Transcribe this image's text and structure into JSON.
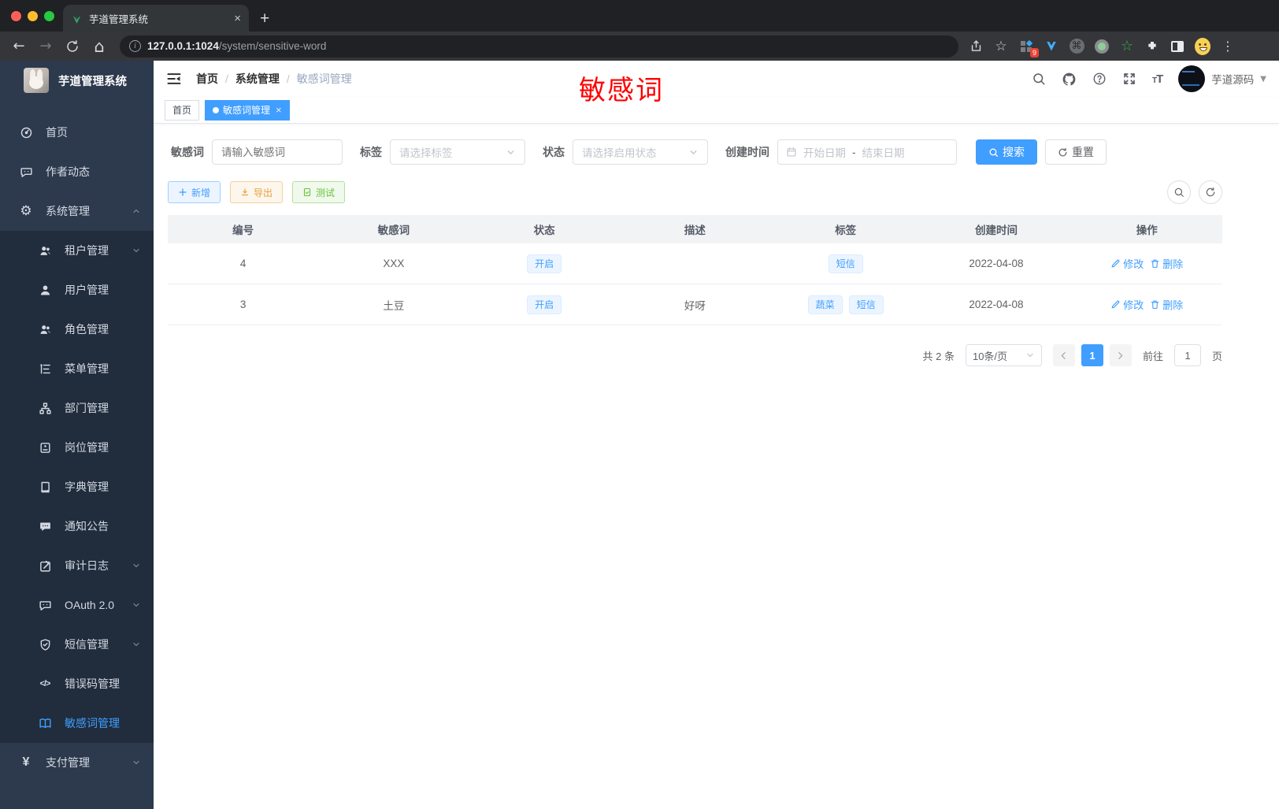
{
  "browser": {
    "tab_title": "芋道管理系统",
    "url_host": "127.0.0.1:1024",
    "url_path": "/system/sensitive-word",
    "extension_badge": "9"
  },
  "sidebar": {
    "title": "芋道管理系统",
    "items": [
      {
        "icon": "dashboard-icon",
        "label": "首页",
        "level": "root",
        "arrow": "",
        "active": false
      },
      {
        "icon": "chat-icon",
        "label": "作者动态",
        "level": "root",
        "arrow": "",
        "active": false
      },
      {
        "icon": "gear-icon",
        "label": "系统管理",
        "level": "root",
        "arrow": "up",
        "active": false
      },
      {
        "icon": "tenant-icon",
        "label": "租户管理",
        "level": "sub",
        "arrow": "down",
        "active": false
      },
      {
        "icon": "user-icon",
        "label": "用户管理",
        "level": "sub",
        "arrow": "",
        "active": false
      },
      {
        "icon": "role-icon",
        "label": "角色管理",
        "level": "sub",
        "arrow": "",
        "active": false
      },
      {
        "icon": "menu-tree-icon",
        "label": "菜单管理",
        "level": "sub",
        "arrow": "",
        "active": false
      },
      {
        "icon": "dept-icon",
        "label": "部门管理",
        "level": "sub",
        "arrow": "",
        "active": false
      },
      {
        "icon": "post-icon",
        "label": "岗位管理",
        "level": "sub",
        "arrow": "",
        "active": false
      },
      {
        "icon": "dict-icon",
        "label": "字典管理",
        "level": "sub",
        "arrow": "",
        "active": false
      },
      {
        "icon": "notice-icon",
        "label": "通知公告",
        "level": "sub",
        "arrow": "",
        "active": false
      },
      {
        "icon": "log-icon",
        "label": "审计日志",
        "level": "sub",
        "arrow": "down",
        "active": false
      },
      {
        "icon": "oauth-icon",
        "label": "OAuth 2.0",
        "level": "sub",
        "arrow": "down",
        "active": false
      },
      {
        "icon": "sms-icon",
        "label": "短信管理",
        "level": "sub",
        "arrow": "down",
        "active": false
      },
      {
        "icon": "code-icon",
        "label": "错误码管理",
        "level": "sub",
        "arrow": "",
        "active": false
      },
      {
        "icon": "book-icon",
        "label": "敏感词管理",
        "level": "sub",
        "arrow": "",
        "active": true
      },
      {
        "icon": "yen-icon",
        "label": "支付管理",
        "level": "root",
        "arrow": "down",
        "active": false
      }
    ]
  },
  "header": {
    "breadcrumb": [
      "首页",
      "系统管理",
      "敏感词管理"
    ],
    "annotation": "敏感词",
    "username": "芋道源码"
  },
  "tags": [
    {
      "label": "首页",
      "active": false
    },
    {
      "label": "敏感词管理",
      "active": true
    }
  ],
  "filters": {
    "keyword_label": "敏感词",
    "keyword_placeholder": "请输入敏感词",
    "tag_label": "标签",
    "tag_placeholder": "请选择标签",
    "status_label": "状态",
    "status_placeholder": "请选择启用状态",
    "date_label": "创建时间",
    "date_start": "开始日期",
    "date_separator": "-",
    "date_end": "结束日期",
    "search_label": "搜索",
    "reset_label": "重置"
  },
  "toolbar": {
    "add_label": "新增",
    "export_label": "导出",
    "test_label": "测试"
  },
  "table": {
    "columns": [
      "编号",
      "敏感词",
      "状态",
      "描述",
      "标签",
      "创建时间",
      "操作"
    ],
    "rows": [
      {
        "id": "4",
        "word": "XXX",
        "status": "开启",
        "desc": "",
        "tags": [
          "短信"
        ],
        "created": "2022-04-08"
      },
      {
        "id": "3",
        "word": "土豆",
        "status": "开启",
        "desc": "好呀",
        "tags": [
          "蔬菜",
          "短信"
        ],
        "created": "2022-04-08"
      }
    ],
    "edit_label": "修改",
    "delete_label": "删除"
  },
  "pagination": {
    "total_label": "共 2 条",
    "page_size": "10条/页",
    "current_page": "1",
    "goto_label": "前往",
    "goto_value": "1",
    "page_unit": "页"
  },
  "colors": {
    "primary": "#409eff",
    "warning": "#e6a23c",
    "success": "#67c23a",
    "annotation_red": "#ff0000",
    "sidebar_bg": "#2d3a4d",
    "submenu_bg": "#212c3c"
  }
}
